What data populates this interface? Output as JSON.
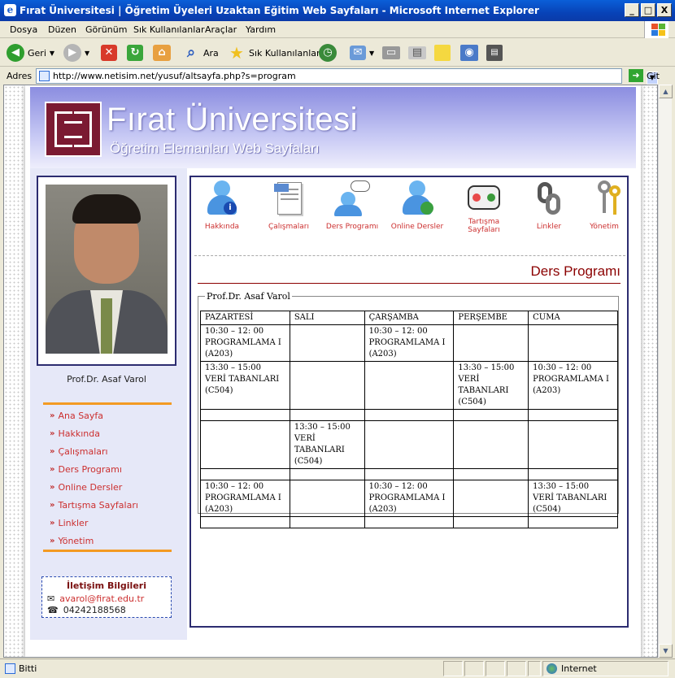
{
  "window": {
    "title": "Fırat Üniversitesi | Öğretim Üyeleri Uzaktan Eğitim Web Sayfaları - Microsoft Internet Explorer",
    "min": "_",
    "max": "□",
    "close": "X"
  },
  "menu": [
    "Dosya",
    "Düzen",
    "Görünüm",
    "Sık Kullanılanlar",
    "Araçlar",
    "Yardım"
  ],
  "toolbar": {
    "back": "Geri",
    "search": "Ara",
    "favorites": "Sık Kullanılanlar"
  },
  "address": {
    "label": "Adres",
    "url": "http://www.netisim.net/yusuf/altsayfa.php?s=program",
    "go": "Git"
  },
  "status": {
    "text": "Bitti",
    "zone": "Internet"
  },
  "banner": {
    "title": "Fırat Üniversitesi",
    "subtitle": "Öğretim Elemanları Web Sayfaları"
  },
  "person": {
    "name": "Prof.Dr. Asaf Varol"
  },
  "nav": [
    "Ana Sayfa",
    "Hakkında",
    "Çalışmaları",
    "Ders Programı",
    "Online Dersler",
    "Tartışma Sayfaları",
    "Linkler",
    "Yönetim"
  ],
  "contact": {
    "heading": "İletişim Bilgileri",
    "email": "avarol@firat.edu.tr",
    "phone": "04242188568"
  },
  "icons": [
    {
      "label": "Hakkında",
      "icon": "user-info-icon"
    },
    {
      "label": "Çalışmaları",
      "icon": "document-icon"
    },
    {
      "label": "Ders Programı",
      "icon": "user-chat-icon"
    },
    {
      "label": "Online Dersler",
      "icon": "user-globe-icon"
    },
    {
      "label": "Tartışma Sayfaları",
      "icon": "discussion-icon"
    },
    {
      "label": "Linkler",
      "icon": "chain-link-icon"
    },
    {
      "label": "Yönetim",
      "icon": "keys-icon"
    }
  ],
  "schedule": {
    "title": "Ders Programı",
    "legend": "Prof.Dr. Asaf Varol",
    "days": [
      "PAZARTESİ",
      "SALI",
      "ÇARŞAMBA",
      "PERŞEMBE",
      "CUMA"
    ],
    "rows": [
      [
        [
          "10:30 – 12: 00",
          "PROGRAMLAMA I",
          "(A203)"
        ],
        [],
        [
          "10:30 – 12: 00",
          "PROGRAMLAMA I",
          "(A203)"
        ],
        [],
        []
      ],
      [
        [
          "13:30 – 15:00",
          "VERİ TABANLARI",
          "(C504)"
        ],
        [],
        [],
        [
          "13:30 – 15:00",
          "VERİ",
          "TABANLARI",
          "(C504)"
        ],
        [
          "10:30 – 12: 00",
          "PROGRAMLAMA I",
          "(A203)"
        ]
      ],
      [
        [],
        [],
        [],
        [],
        []
      ],
      [
        [],
        [
          "13:30 – 15:00",
          "VERİ",
          "TABANLARI",
          "(C504)"
        ],
        [],
        [],
        []
      ],
      [
        [],
        [],
        [],
        [],
        []
      ],
      [
        [
          "10:30 – 12: 00",
          "PROGRAMLAMA I",
          "(A203)"
        ],
        [],
        [
          "10:30 – 12: 00",
          "PROGRAMLAMA I",
          "(A203)"
        ],
        [],
        [
          "13:30 – 15:00",
          "VERİ TABANLARI",
          "(C504)"
        ]
      ],
      [
        [],
        [],
        [],
        [],
        []
      ]
    ]
  }
}
